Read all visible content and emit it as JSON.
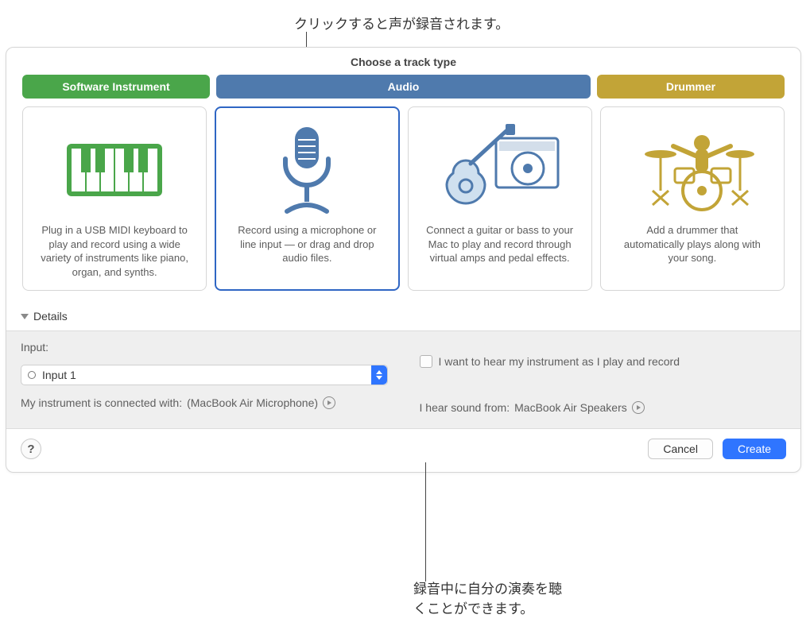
{
  "callouts": {
    "top": "クリックすると声が録音されます。",
    "bottom": "録音中に自分の演奏を聴\nくことができます。"
  },
  "dialog": {
    "title": "Choose a track type",
    "types": {
      "software": "Software Instrument",
      "audio": "Audio",
      "drummer": "Drummer"
    },
    "cards": [
      {
        "desc": "Plug in a USB MIDI keyboard to play and record using a wide variety of instruments like piano, organ, and synths."
      },
      {
        "desc": "Record using a microphone or line input — or drag and drop audio files."
      },
      {
        "desc": "Connect a guitar or bass to your Mac to play and record through virtual amps and pedal effects."
      },
      {
        "desc": "Add a drummer that automatically plays along with your song."
      }
    ],
    "details_label": "Details",
    "input_label": "Input:",
    "input_value": "Input 1",
    "connected_prefix": "My instrument is connected with: ",
    "connected_device": "(MacBook Air Microphone)",
    "monitor_label": "I want to hear my instrument as I play and record",
    "output_prefix": "I hear sound from: ",
    "output_device": "MacBook Air Speakers",
    "cancel": "Cancel",
    "create": "Create",
    "help": "?"
  }
}
